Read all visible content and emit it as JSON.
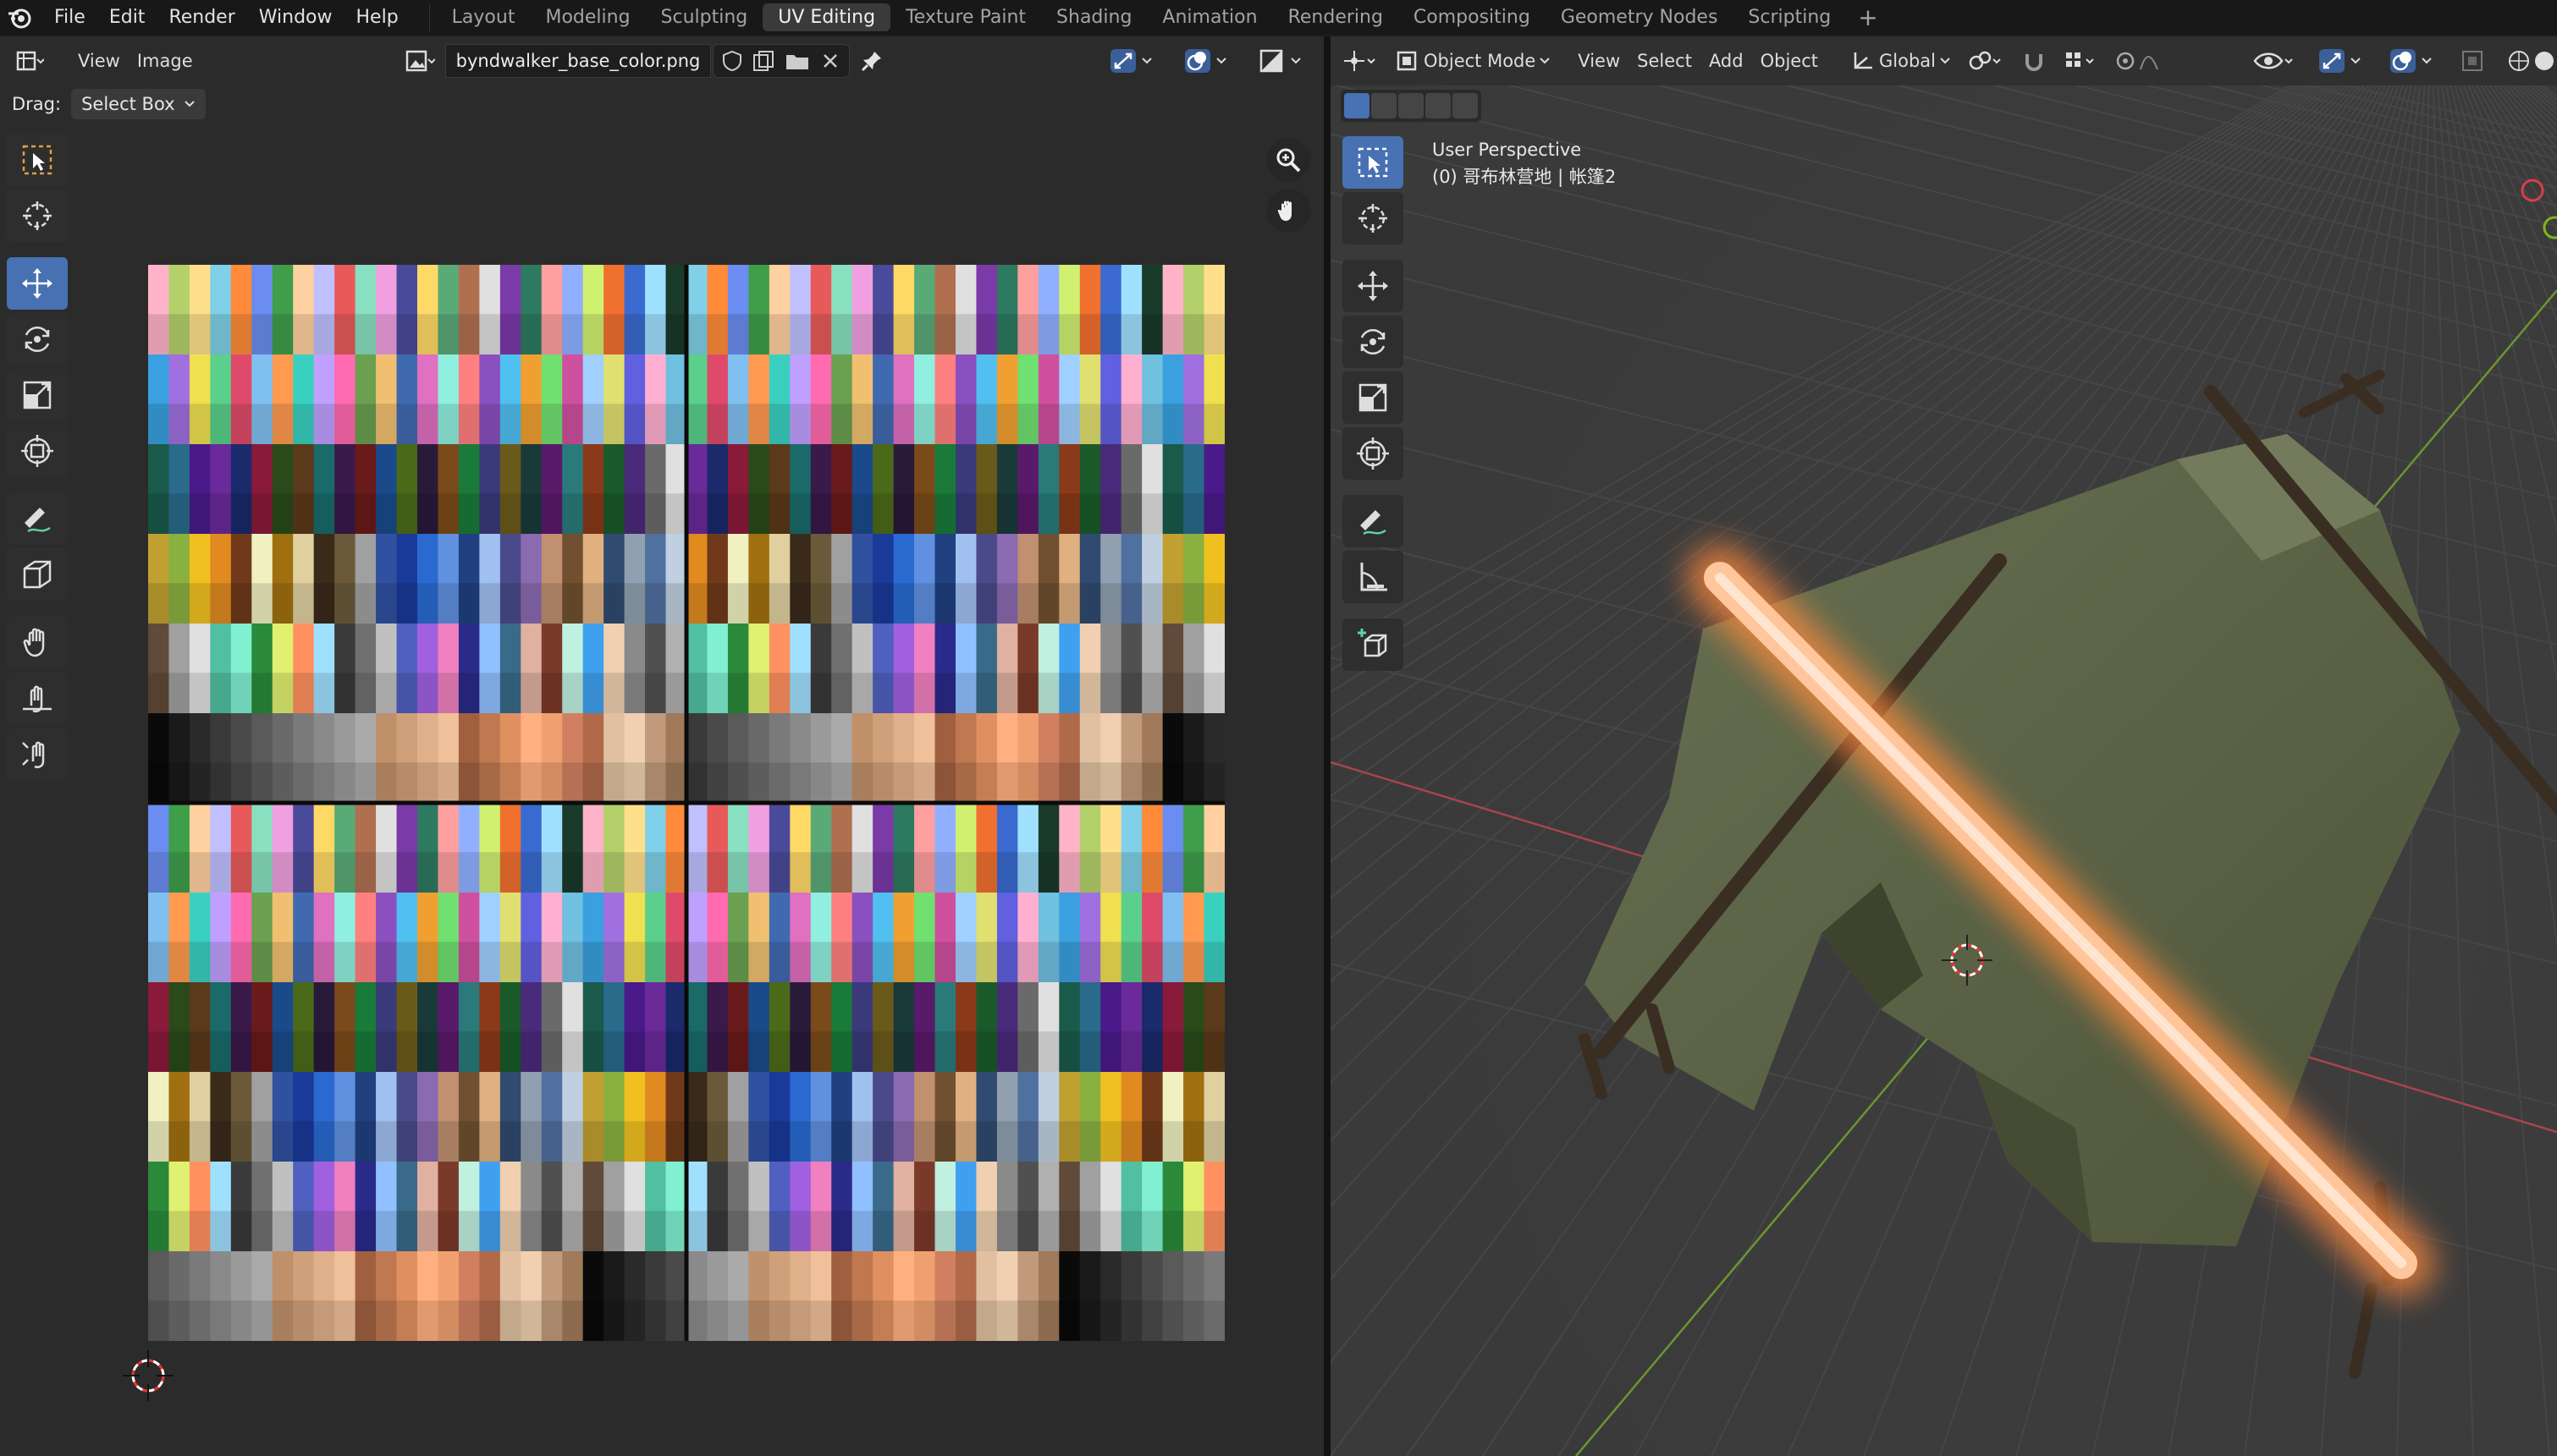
{
  "menubar": {
    "items": [
      "File",
      "Edit",
      "Render",
      "Window",
      "Help"
    ]
  },
  "workspaces": {
    "tabs": [
      "Layout",
      "Modeling",
      "Sculpting",
      "UV Editing",
      "Texture Paint",
      "Shading",
      "Animation",
      "Rendering",
      "Compositing",
      "Geometry Nodes",
      "Scripting"
    ],
    "active": "UV Editing",
    "add_symbol": "+"
  },
  "uv_editor": {
    "view_menu": "View",
    "image_menu": "Image",
    "image_name": "byndwalker_base_color.png",
    "drag_label": "Drag:",
    "drag_value": "Select Box",
    "tools": [
      "select-box-icon",
      "cursor-icon",
      "move-icon",
      "rotate-icon",
      "scale-icon",
      "transform-icon",
      "annotate-icon",
      "rip-region-icon",
      "grab-icon",
      "relax-icon",
      "pinch-icon"
    ]
  },
  "viewport": {
    "mode": "Object Mode",
    "view_menu": "View",
    "select_menu": "Select",
    "add_menu": "Add",
    "object_menu": "Object",
    "orientation": "Global",
    "perspective": "User Perspective",
    "object_info": "(0) 哥布林营地 | 帐篷2",
    "tools": [
      "select-box-icon",
      "cursor-icon",
      "move-icon",
      "rotate-icon",
      "scale-icon",
      "transform-icon",
      "annotate-icon",
      "measure-icon",
      "add-cube-icon"
    ]
  },
  "colors": {
    "accent": "#4772b3",
    "tent": "#5b6244",
    "glow": "#ffb07a",
    "grid_red": "#b8434a",
    "grid_green": "#6f9a33"
  }
}
